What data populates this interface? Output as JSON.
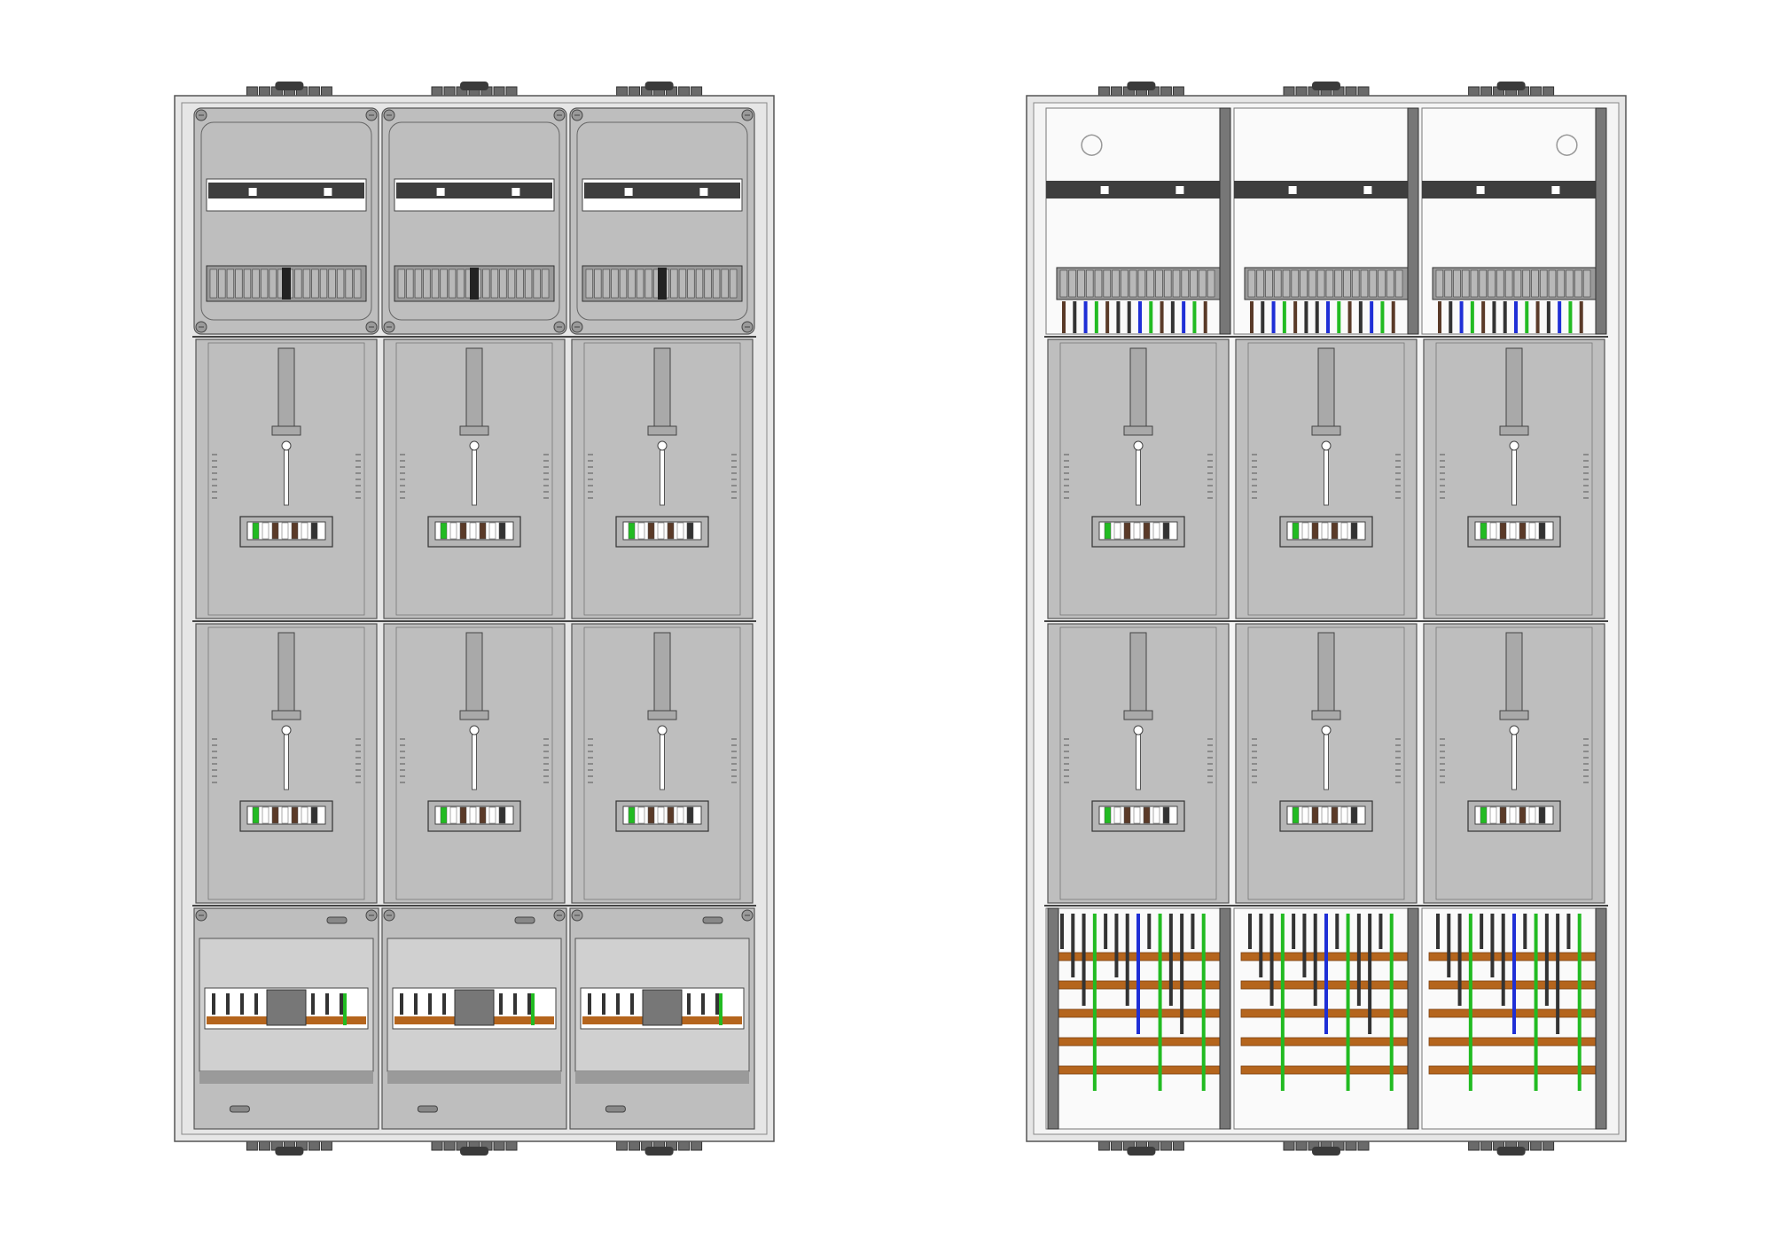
{
  "cabinets": [
    {
      "view": "covered",
      "columns": 3,
      "top_sections": "covered-din-rail-with-terminal-blocks",
      "meter_rows": 2,
      "bottom_sections": "covered-busbar-with-breakers"
    },
    {
      "view": "open-wired",
      "columns": 3,
      "top_sections": "open-din-rail-with-wired-terminals",
      "meter_rows": 2,
      "bottom_sections": "open-busbar-with-wiring"
    }
  ],
  "colors": {
    "panel": "#bebebe",
    "panel_dark": "#aaaaaa",
    "frame": "#e6e6e6",
    "outline": "#555555",
    "rail": "#3e3e3e",
    "busbar": "#b5651d",
    "wire_green": "#22bb22",
    "wire_blue": "#1f2fd6",
    "wire_brown": "#5a3a28",
    "wire_black": "#333333",
    "white": "#ffffff"
  },
  "icons": [
    "cable-gland-icon",
    "screw-icon",
    "keyhole-icon",
    "terminal-block-icon"
  ]
}
